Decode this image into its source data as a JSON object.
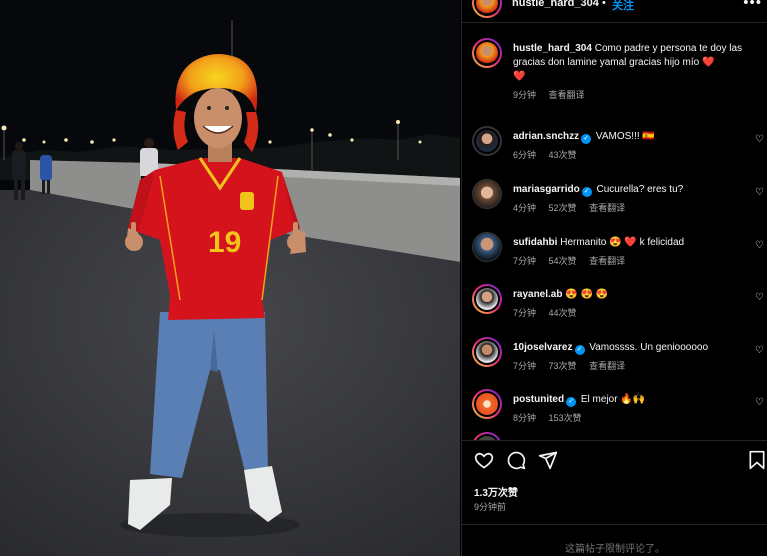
{
  "photo": {
    "jersey_number": "19",
    "colors": {
      "sky": "#07080c",
      "ground": "#3a3b40",
      "jersey": "#d5131d",
      "jeans": "#5a7fb5",
      "wig_yellow": "#f2c318",
      "wig_red": "#d32b17",
      "wall": "#9c9c9a"
    }
  },
  "post": {
    "username": "hustle_hard_304",
    "separator": "•",
    "follow_label": "关注",
    "more_icon": "more-icon",
    "likes": "1.3万次赞",
    "time": "9分钟前",
    "comments_limited": "这篇帖子限制评论了。"
  },
  "comments": [
    {
      "user": "hustle_hard_304",
      "text": "Como padre y persona te doy las gracias don lamine yamal gracias hijo mío ❤️",
      "extra_line": "❤️",
      "time": "9分钟",
      "likes": "",
      "translate": "查看翻译",
      "verified": false,
      "like_button": false
    },
    {
      "user": "adrian.snchzz",
      "text": "VAMOS!!! 🇪🇸",
      "time": "6分钟",
      "likes": "43次赞",
      "translate": "",
      "verified": true,
      "like_button": true
    },
    {
      "user": "mariasgarrido",
      "text": "Cucurella? eres tu?",
      "time": "4分钟",
      "likes": "52次赞",
      "translate": "查看翻译",
      "verified": true,
      "like_button": true
    },
    {
      "user": "sufidahbi",
      "text": "Hermanito 😍 ❤️ k felicidad",
      "time": "7分钟",
      "likes": "54次赞",
      "translate": "查看翻译",
      "verified": false,
      "like_button": true
    },
    {
      "user": "rayanel.ab",
      "text": "😍 😍 😍",
      "time": "7分钟",
      "likes": "44次赞",
      "translate": "",
      "verified": false,
      "like_button": true
    },
    {
      "user": "10joselvarez",
      "text": "Vamossss. Un genioooooo",
      "time": "7分钟",
      "likes": "73次赞",
      "translate": "查看翻译",
      "verified": true,
      "like_button": true
    },
    {
      "user": "postunited",
      "text": "El mejor 🔥🙌",
      "time": "8分钟",
      "likes": "153次赞",
      "translate": "",
      "verified": true,
      "like_button": true
    }
  ],
  "icons": [
    "heart-icon",
    "comment-icon",
    "share-icon",
    "bookmark-icon",
    "verified-icon"
  ]
}
